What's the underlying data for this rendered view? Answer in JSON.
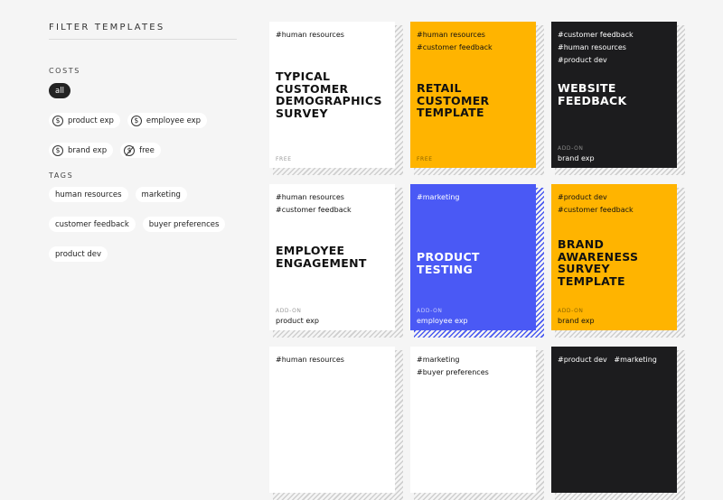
{
  "sidebar": {
    "title": "FILTER TEMPLATES",
    "costs_title": "COSTS",
    "costs": [
      {
        "label": "all",
        "icon": ""
      },
      {
        "label": "product exp",
        "icon": "dollar-coin-icon"
      },
      {
        "label": "employee exp",
        "icon": "dollar-coin-icon"
      },
      {
        "label": "brand exp",
        "icon": "dollar-coin-icon"
      },
      {
        "label": "free",
        "icon": "no-dollar-icon"
      }
    ],
    "tags_title": "TAGS",
    "tags": [
      "human resources",
      "marketing",
      "customer feedback",
      "buyer preferences",
      "product dev"
    ]
  },
  "cards": [
    {
      "style": "white",
      "tags": [
        "#human resources"
      ],
      "title": "Typical Customer Demographics Survey",
      "foot_label": "FREE",
      "foot_value": ""
    },
    {
      "style": "yellow",
      "tags": [
        "#human resources",
        "#customer feedback"
      ],
      "title": "Retail Customer Template",
      "foot_label": "FREE",
      "foot_value": ""
    },
    {
      "style": "black",
      "tags": [
        "#customer feedback",
        "#human resources",
        "#product dev"
      ],
      "title": "Website Feedback",
      "foot_label": "ADD-ON",
      "foot_value": "brand exp"
    },
    {
      "style": "white",
      "tags": [
        "#human resources",
        "#customer feedback"
      ],
      "title": "Employee Engagement",
      "foot_label": "ADD-ON",
      "foot_value": "product exp"
    },
    {
      "style": "blue",
      "tags": [
        "#marketing"
      ],
      "title": "Product Testing",
      "foot_label": "ADD-ON",
      "foot_value": "employee exp"
    },
    {
      "style": "yellow",
      "tags": [
        "#product dev",
        "#customer feedback"
      ],
      "title": "Brand Awareness Survey Template",
      "foot_label": "ADD-ON",
      "foot_value": "brand exp"
    },
    {
      "style": "white",
      "tags": [
        "#human resources"
      ],
      "title": "",
      "foot_label": "",
      "foot_value": ""
    },
    {
      "style": "white",
      "tags": [
        "#marketing",
        "#buyer preferences"
      ],
      "title": "",
      "foot_label": "",
      "foot_value": ""
    },
    {
      "style": "black",
      "tags": [
        "#product dev   #marketing"
      ],
      "title": "",
      "foot_label": "",
      "foot_value": ""
    }
  ]
}
